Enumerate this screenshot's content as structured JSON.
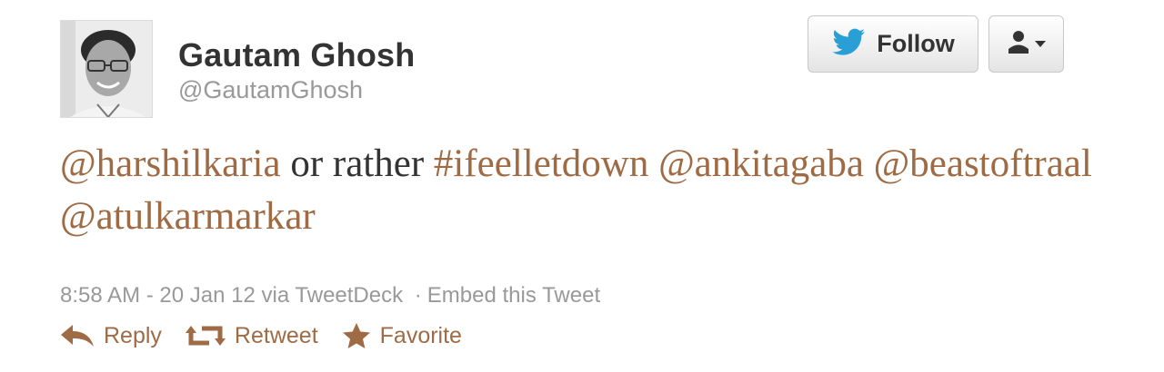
{
  "user": {
    "name": "Gautam Ghosh",
    "handle": "@GautamGhosh"
  },
  "buttons": {
    "follow_label": "Follow",
    "follow_icon": "twitter-bird-icon",
    "user_menu_icon": "person-dropdown-icon"
  },
  "tweet": {
    "parts": [
      {
        "text": "@harshilkaria",
        "type": "mention"
      },
      {
        "text": " or rather ",
        "type": "text"
      },
      {
        "text": "#ifeelletdown",
        "type": "hashtag"
      },
      {
        "text": " ",
        "type": "text"
      },
      {
        "text": "@ankitagaba",
        "type": "mention"
      },
      {
        "text": " ",
        "type": "text"
      },
      {
        "text": "@beastoftraal",
        "type": "mention"
      },
      {
        "text": " ",
        "type": "text"
      },
      {
        "text": "@atulkarmarkar",
        "type": "mention"
      }
    ]
  },
  "meta": {
    "timestamp": "8:58 AM - 20 Jan 12",
    "via": "via TweetDeck",
    "separator": "·",
    "embed": "Embed this Tweet"
  },
  "actions": {
    "reply": "Reply",
    "retweet": "Retweet",
    "favorite": "Favorite"
  },
  "colors": {
    "link": "#9e6b45",
    "text": "#333333",
    "muted": "#999999",
    "bird": "#2a9fd6"
  }
}
